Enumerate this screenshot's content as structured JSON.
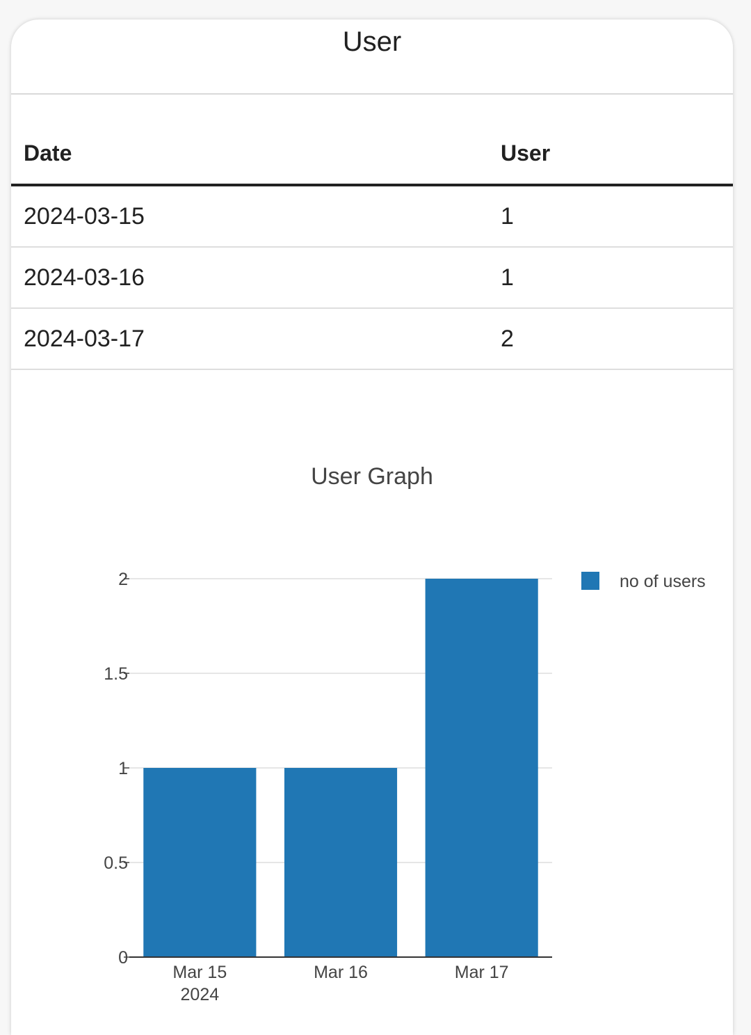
{
  "page": {
    "title": "User"
  },
  "table": {
    "headers": [
      "Date",
      "User"
    ],
    "rows": [
      [
        "2024-03-15",
        "1"
      ],
      [
        "2024-03-16",
        "1"
      ],
      [
        "2024-03-17",
        "2"
      ]
    ]
  },
  "chart_data": {
    "type": "bar",
    "title": "User Graph",
    "categories": [
      "Mar 15",
      "Mar 16",
      "Mar 17"
    ],
    "category_year": "2024",
    "series": [
      {
        "name": "no of users",
        "values": [
          1,
          1,
          2
        ]
      }
    ],
    "ylim": [
      0,
      2
    ],
    "yticks": [
      "0",
      "0.5",
      "1",
      "1.5",
      "2"
    ],
    "grid": true,
    "legend": "top-right",
    "bar_color": "#2077b4"
  }
}
